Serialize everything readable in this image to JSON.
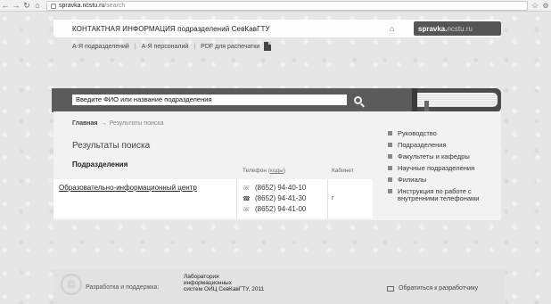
{
  "browser": {
    "url_host": "spravka.ncstu.ru",
    "url_path": "/search",
    "back_icon": "←",
    "forward_icon": "→",
    "reload_icon": "↻",
    "home_icon": "⌂",
    "star_icon": "☆",
    "wrench_icon": "🔧"
  },
  "header": {
    "title": "КОНТАКТНАЯ ИНФОРМАЦИЯ подразделений СевКавГТУ",
    "logo_bold": "spravka.",
    "logo_light": "ncstu.",
    "logo_end": "ru",
    "links": [
      "А-Я подразделений",
      "А-Я персоналий",
      "PDF для распечатки"
    ]
  },
  "search": {
    "placeholder": "Введите ФИО или название подразделения"
  },
  "breadcrumb": {
    "home": "Главная",
    "arrow": "→",
    "current": "Результаты поиска"
  },
  "main": {
    "title": "Результаты поиска",
    "section": "Подразделения",
    "phone_header": "Телефон",
    "phone_codes_label": "коды",
    "cabinet_header": "Кабинет",
    "result": {
      "name": "Образовательно-информационный центр",
      "phones": [
        "(8652) 94-40-10",
        "(8652) 94-41-30",
        "(8652) 94-41-00"
      ],
      "cabinet": "г"
    }
  },
  "sidebar": {
    "items": [
      "Руководство",
      "Подразделения",
      "Факультеты и кафедры",
      "Научные подразделения",
      "Филиалы",
      "Инструкция по работе с внутренними телефонами"
    ]
  },
  "footer": {
    "dev_label": "Разработка и поддержка:",
    "lab_line1": "Лаборатория",
    "lab_line2": "информационных",
    "lab_line3": "систем ОИЦ СевКавГТУ, 2011",
    "contact": "Обратиться к разработчику"
  }
}
